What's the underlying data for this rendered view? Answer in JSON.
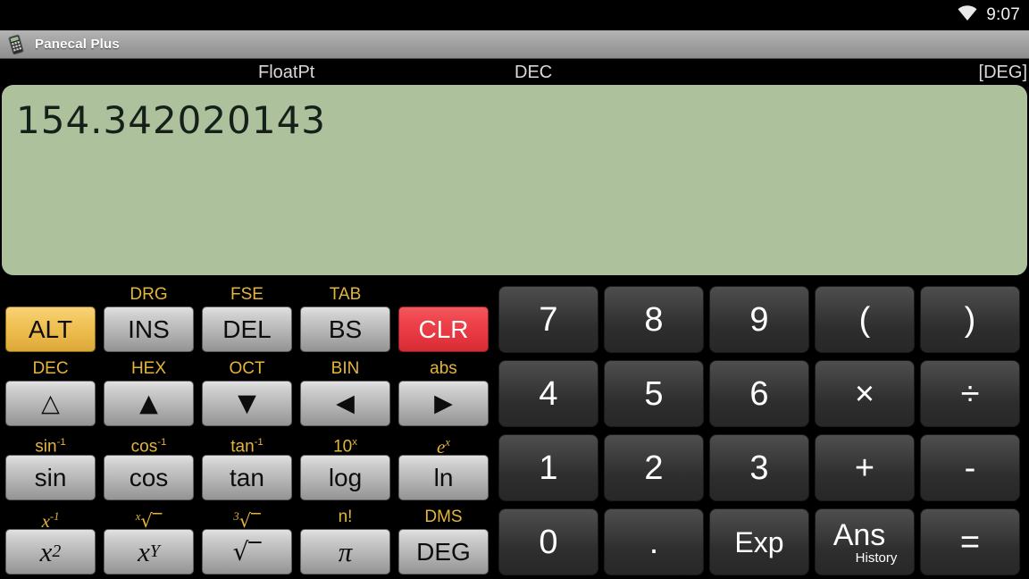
{
  "statusbar": {
    "wifi_icon": "wifi-icon",
    "time": "9:07"
  },
  "titlebar": {
    "icon": "calculator-app-icon",
    "title": "Panecal Plus"
  },
  "modes": {
    "notation": "FloatPt",
    "base": "DEC",
    "angle": "[DEG]"
  },
  "display": {
    "value": "154.342020143",
    "background_color": "#adc19c"
  },
  "colors": {
    "alt_label": "#e3b53c",
    "alt_key": "#f0c45a",
    "clear_key": "#ee4149",
    "gray_key": "#c4c4c4",
    "dark_key": "#3a3a3a"
  },
  "keypad_left": [
    {
      "keys": [
        {
          "alt": "",
          "label": "ALT",
          "style": "gold"
        },
        {
          "alt": "DRG",
          "label": "INS",
          "style": "gray"
        },
        {
          "alt": "FSE",
          "label": "DEL",
          "style": "gray"
        },
        {
          "alt": "TAB",
          "label": "BS",
          "style": "gray"
        },
        {
          "alt": "",
          "label": "CLR",
          "style": "red"
        }
      ]
    },
    {
      "keys": [
        {
          "alt": "DEC",
          "label": "△",
          "style": "gray"
        },
        {
          "alt": "HEX",
          "label": "▲",
          "style": "gray"
        },
        {
          "alt": "OCT",
          "label": "▼",
          "style": "gray"
        },
        {
          "alt": "BIN",
          "label": "◀",
          "style": "gray"
        },
        {
          "alt": "abs",
          "label": "▶",
          "style": "gray"
        }
      ]
    },
    {
      "keys": [
        {
          "alt": "sin-1",
          "label": "sin",
          "style": "gray"
        },
        {
          "alt": "cos-1",
          "label": "cos",
          "style": "gray"
        },
        {
          "alt": "tan-1",
          "label": "tan",
          "style": "gray"
        },
        {
          "alt": "10x",
          "label": "log",
          "style": "gray"
        },
        {
          "alt": "ex",
          "label": "ln",
          "style": "gray"
        }
      ]
    },
    {
      "keys": [
        {
          "alt": "x-1",
          "label": "x2",
          "style": "gray"
        },
        {
          "alt": "xroot",
          "label": "xY",
          "style": "gray"
        },
        {
          "alt": "3root",
          "label": "sqrt",
          "style": "gray"
        },
        {
          "alt": "n!",
          "label": "pi",
          "style": "gray"
        },
        {
          "alt": "DMS",
          "label": "DEG",
          "style": "gray"
        }
      ]
    }
  ],
  "keypad_right": [
    {
      "keys": [
        "7",
        "8",
        "9",
        "(",
        ")"
      ]
    },
    {
      "keys": [
        "4",
        "5",
        "6",
        "×",
        "÷"
      ]
    },
    {
      "keys": [
        "1",
        "2",
        "3",
        "+",
        "-"
      ]
    },
    {
      "keys": [
        "0",
        ".",
        "Exp",
        "Ans",
        "="
      ]
    }
  ],
  "ans_key": {
    "main": "Ans",
    "sub": "History"
  }
}
